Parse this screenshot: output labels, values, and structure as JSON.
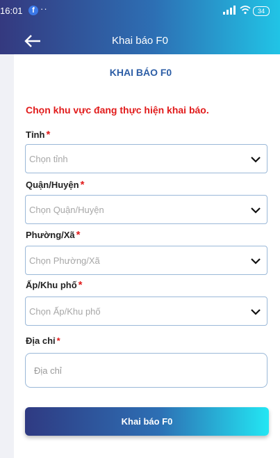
{
  "status_bar": {
    "time": "16:01",
    "notification_dots": "··",
    "battery": "34"
  },
  "header": {
    "title": "Khai báo F0"
  },
  "form": {
    "heading": "KHAI BÁO F0",
    "instruction": "Chọn khu vực đang thực hiện khai báo.",
    "required_mark": "*",
    "fields": [
      {
        "label": "Tỉnh",
        "placeholder": "Chọn tỉnh"
      },
      {
        "label": "Quận/Huyện",
        "placeholder": "Chọn Quận/Huyện"
      },
      {
        "label": "Phường/Xã",
        "placeholder": "Chọn Phường/Xã"
      },
      {
        "label": "Ấp/Khu phố",
        "placeholder": "Chọn Ấp/Khu phố"
      }
    ],
    "address": {
      "label": "Địa chỉ",
      "placeholder": "Địa chỉ"
    },
    "submit_label": "Khai báo F0"
  },
  "colors": {
    "header_gradient": [
      "#34397f",
      "#2d6fb4",
      "#21c4e6"
    ],
    "required": "#e11b1b",
    "heading": "#2d5ea6",
    "field_border": "#9ab8d8"
  }
}
